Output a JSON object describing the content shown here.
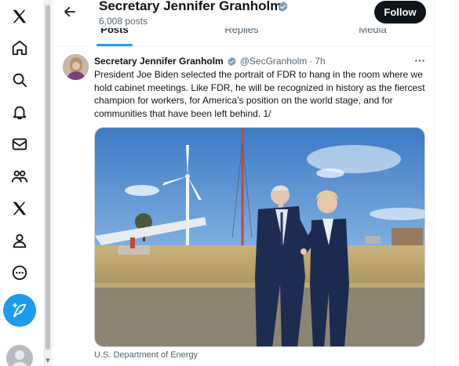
{
  "nav": {
    "items": [
      {
        "icon": "x-logo-icon"
      },
      {
        "icon": "home-icon"
      },
      {
        "icon": "search-icon"
      },
      {
        "icon": "bell-icon"
      },
      {
        "icon": "mail-icon"
      },
      {
        "icon": "communities-icon"
      },
      {
        "icon": "x-premium-icon"
      },
      {
        "icon": "profile-icon"
      },
      {
        "icon": "more-circle-icon"
      }
    ],
    "post_icon": "feather-plus-icon"
  },
  "header": {
    "title": "Secretary Jennifer Granholm",
    "post_count": "6,008 posts",
    "follow_label": "Follow"
  },
  "tabs": [
    {
      "label": "Posts",
      "active": true
    },
    {
      "label": "Replies",
      "active": false
    },
    {
      "label": "Media",
      "active": false
    }
  ],
  "tweet": {
    "name": "Secretary Jennifer Granholm",
    "handle": "@SecGranholm",
    "separator": "·",
    "time": "7h",
    "text": "President Joe Biden selected the portrait of FDR to hang in the room where we hold cabinet meetings. Like FDR, he will be recognized in history as the fiercest champion for workers, for America’s position on the world stage, and for communities that have been left behind. 1/",
    "media_caption": "U.S. Department of Energy"
  },
  "colors": {
    "accent": "#1d9bf0",
    "text_primary": "#0f1419",
    "text_secondary": "#536471",
    "follow_bg": "#0f1419"
  }
}
